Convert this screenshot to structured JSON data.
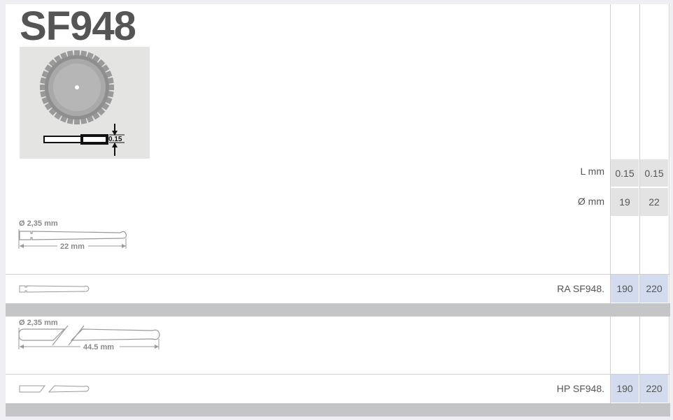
{
  "product": {
    "code": "SF948",
    "detail_label": "0.15"
  },
  "spec_rows": [
    {
      "label": "L mm",
      "values": [
        "0.15",
        "0.15"
      ]
    },
    {
      "label": "Ø mm",
      "values": [
        "19",
        "22"
      ]
    }
  ],
  "shank_ra": {
    "diameter": "Ø 2,35 mm",
    "length": "22 mm",
    "order_code": "RA SF948.",
    "values": [
      "190",
      "220"
    ]
  },
  "shank_hp": {
    "diameter": "Ø 2,35 mm",
    "length": "44.5 mm",
    "order_code": "HP SF948.",
    "values": [
      "190",
      "220"
    ]
  },
  "colors": {
    "grey_cell": "#e3e3e3",
    "blue_cell": "#d3dbee",
    "band": "#c4c5c7"
  }
}
